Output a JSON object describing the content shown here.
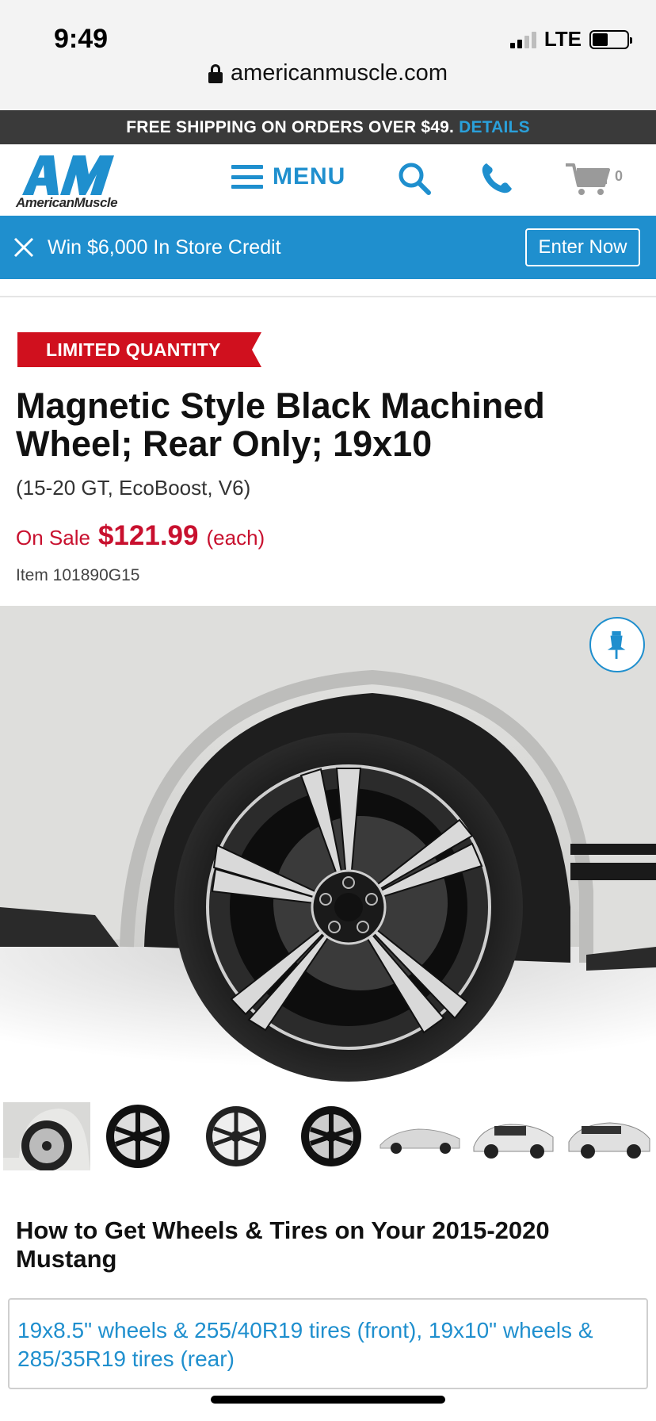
{
  "status_bar": {
    "time": "9:49",
    "network": "LTE",
    "url": "americanmuscle.com"
  },
  "promo": {
    "text": "FREE SHIPPING ON ORDERS OVER $49.",
    "link": "DETAILS"
  },
  "header": {
    "logo_text": "AmericanMuscle",
    "menu_label": "MENU",
    "cart_count": "0"
  },
  "contest": {
    "text": "Win $6,000 In Store Credit",
    "button": "Enter Now"
  },
  "product": {
    "badge": "LIMITED QUANTITY",
    "title": "Magnetic Style Black Machined Wheel; Rear Only; 19x10",
    "fitment": "(15-20 GT, EcoBoost, V6)",
    "sale_label": "On Sale",
    "price": "$121.99",
    "price_unit": "(each)",
    "item_number": "Item 101890G15"
  },
  "howto": {
    "title": "How to Get Wheels & Tires on Your 2015-2020 Mustang",
    "link": "19x8.5\" wheels & 255/40R19 tires (front), 19x10\" wheels & 285/35R19 tires (rear)"
  },
  "colors": {
    "brand_blue": "#1f8fce",
    "sale_red": "#c8102e",
    "promo_bg": "#3a3a3a"
  },
  "icons": [
    "lock-icon",
    "hamburger-icon",
    "search-icon",
    "phone-icon",
    "cart-icon",
    "close-icon",
    "pin-icon"
  ]
}
